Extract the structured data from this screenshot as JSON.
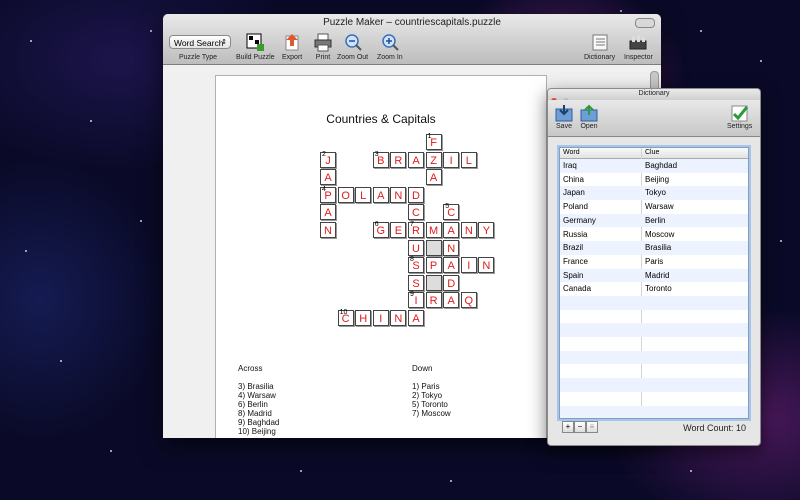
{
  "main_window": {
    "title": "Puzzle Maker – countriescapitals.puzzle",
    "toolbar": {
      "puzzle_type_value": "Word Search",
      "puzzle_type_label": "Puzzle Type",
      "build_puzzle": "Build Puzzle",
      "export": "Export",
      "print": "Print",
      "zoom_out": "Zoom Out",
      "zoom_in": "Zoom In",
      "dictionary": "Dictionary",
      "inspector": "Inspector"
    }
  },
  "puzzle": {
    "title": "Countries & Capitals",
    "across_heading": "Across",
    "down_heading": "Down",
    "across_clues": [
      "3) Brasilia",
      "4) Warsaw",
      "6) Berlin",
      "8) Madrid",
      "9) Baghdad",
      "10) Beijing"
    ],
    "down_clues": [
      "1) Paris",
      "2) Tokyo",
      "5) Toronto",
      "7) Moscow"
    ]
  },
  "dictionary": {
    "title": "Dictionary",
    "save": "Save",
    "open": "Open",
    "settings": "Settings",
    "col_word": "Word",
    "col_clue": "Clue",
    "rows": [
      {
        "word": "Iraq",
        "clue": "Baghdad"
      },
      {
        "word": "China",
        "clue": "Beijing"
      },
      {
        "word": "Japan",
        "clue": "Tokyo"
      },
      {
        "word": "Poland",
        "clue": "Warsaw"
      },
      {
        "word": "Germany",
        "clue": "Berlin"
      },
      {
        "word": "Russia",
        "clue": "Moscow"
      },
      {
        "word": "Brazil",
        "clue": "Brasilia"
      },
      {
        "word": "France",
        "clue": "Paris"
      },
      {
        "word": "Spain",
        "clue": "Madrid"
      },
      {
        "word": "Canada",
        "clue": "Toronto"
      }
    ],
    "word_count": "Word Count: 10",
    "add": "+",
    "remove": "−"
  },
  "colors": {
    "letter": "#e21a1a"
  }
}
